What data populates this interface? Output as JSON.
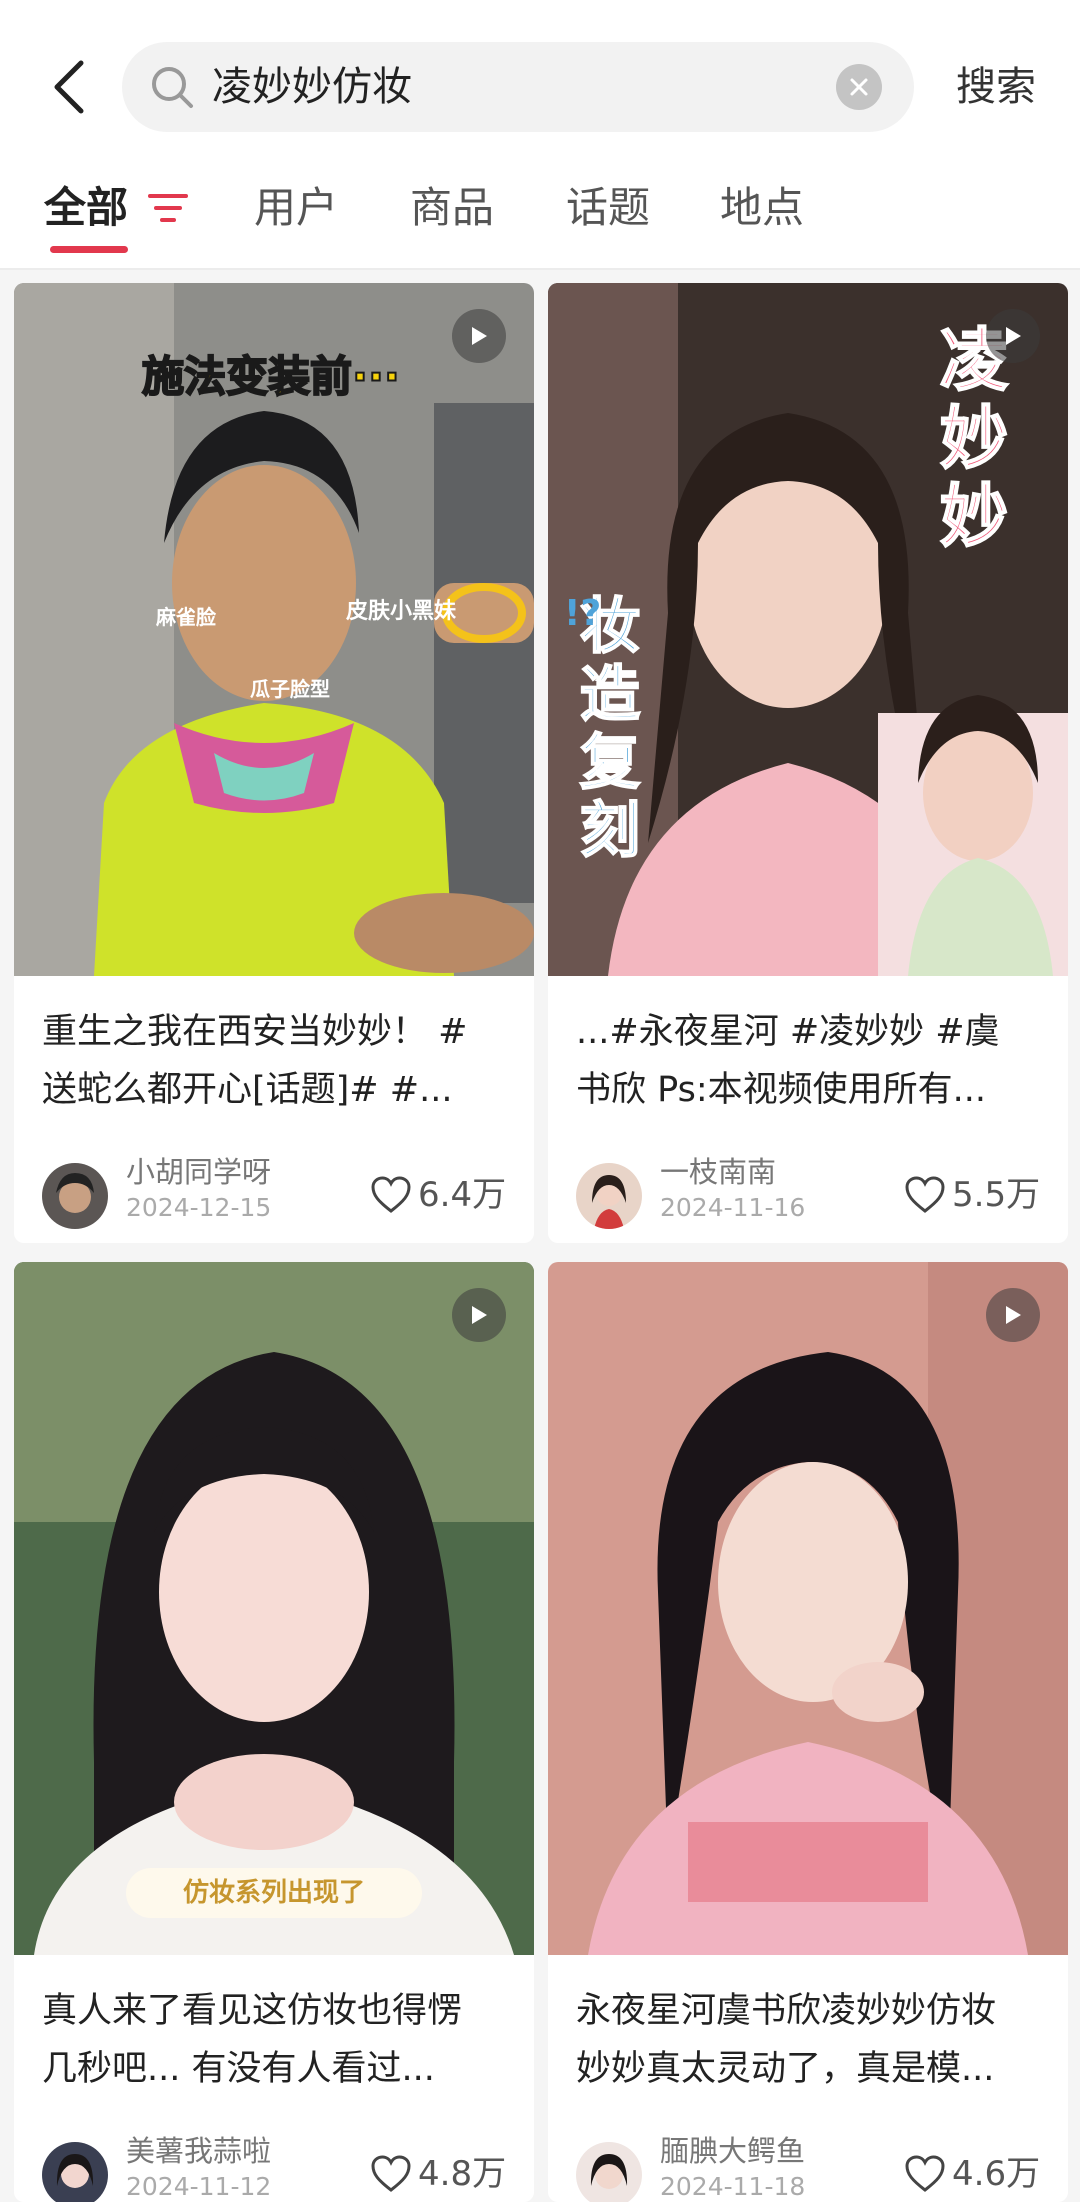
{
  "search": {
    "query": "凌妙妙仿妆",
    "action_label": "搜索"
  },
  "tabs": [
    {
      "label": "全部"
    },
    {
      "label": "用户"
    },
    {
      "label": "商品"
    },
    {
      "label": "话题"
    },
    {
      "label": "地点"
    }
  ],
  "accent_color": "#e2384d",
  "cards": [
    {
      "overlay": {
        "title": "施法变装前···",
        "label1": "麻雀脸",
        "label2": "皮肤小黑妹",
        "label3": "瓜子脸型"
      },
      "caption_line1": "重生之我在西安当妙妙！ #",
      "caption_line2": "送蛇么都开心[话题]# #...",
      "author": "小胡同学呀",
      "date": "2024-12-15",
      "likes": "6.4万"
    },
    {
      "overlay": {
        "title_v": "凌妙妙",
        "sub_v": "妆造复刻",
        "marks": "!?"
      },
      "caption_line1": "...#永夜星河 #凌妙妙 #虞",
      "caption_line2": "书欣 Ps:本视频使用所有...",
      "author": "一枝南南",
      "date": "2024-11-16",
      "likes": "5.5万"
    },
    {
      "overlay": {
        "badge": "仿妆系列出现了"
      },
      "caption_line1": "真人来了看见这仿妆也得愣",
      "caption_line2": "几秒吧... 有没有人看过...",
      "author": "美薯我蒜啦",
      "date": "2024-11-12",
      "likes": "4.8万"
    },
    {
      "overlay": {},
      "caption_line1": "永夜星河虞书欣凌妙妙仿妆",
      "caption_line2": "妙妙真太灵动了，真是模...",
      "author": "腼腆大鳄鱼",
      "date": "2024-11-18",
      "likes": "4.6万"
    }
  ]
}
